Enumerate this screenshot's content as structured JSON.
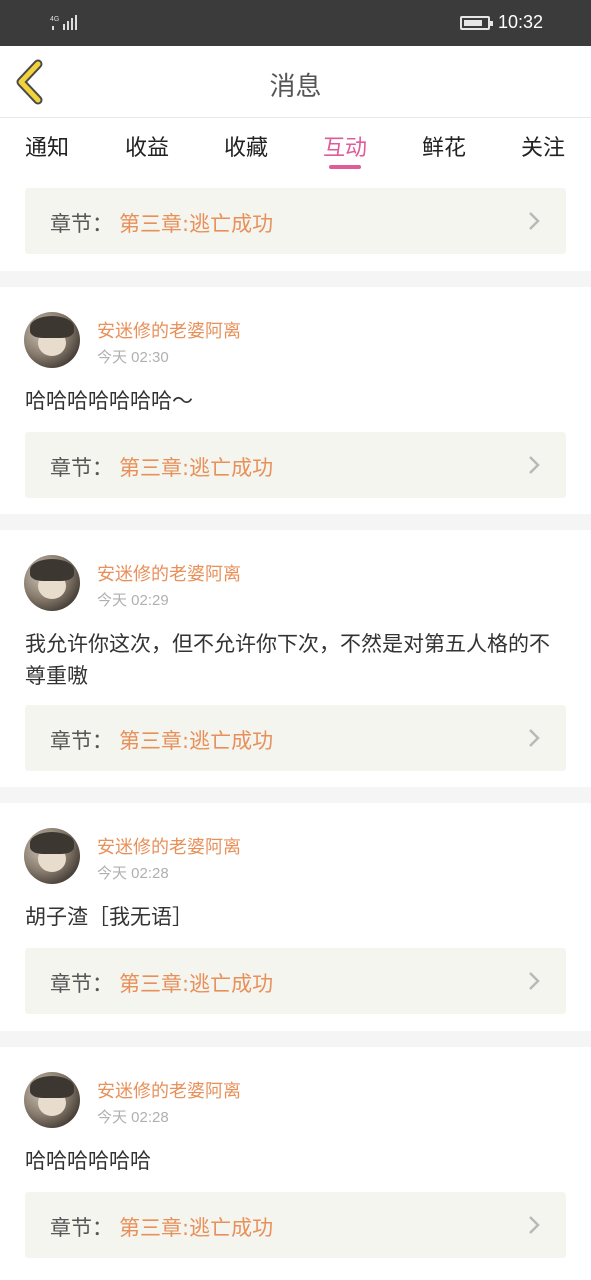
{
  "status_bar": {
    "network": "4G",
    "time": "10:32"
  },
  "header": {
    "title": "消息"
  },
  "tabs": [
    {
      "label": "通知"
    },
    {
      "label": "收益"
    },
    {
      "label": "收藏"
    },
    {
      "label": "互动",
      "active": true
    },
    {
      "label": "鲜花"
    },
    {
      "label": "关注"
    }
  ],
  "chapter_prefix": "章节：",
  "top_chapter": "第三章:逃亡成功",
  "messages": [
    {
      "user": "安迷修的老婆阿离",
      "time": "今天 02:30",
      "text": "哈哈哈哈哈哈哈～",
      "chapter": "第三章:逃亡成功"
    },
    {
      "user": "安迷修的老婆阿离",
      "time": "今天 02:29",
      "text": "我允许你这次，但不允许你下次，不然是对第五人格的不尊重嗷",
      "chapter": "第三章:逃亡成功"
    },
    {
      "user": "安迷修的老婆阿离",
      "time": "今天 02:28",
      "text": "胡子渣［我无语］",
      "chapter": "第三章:逃亡成功"
    },
    {
      "user": "安迷修的老婆阿离",
      "time": "今天 02:28",
      "text": "哈哈哈哈哈哈",
      "chapter": "第三章:逃亡成功"
    }
  ],
  "colors": {
    "accent": "#e05c98",
    "username": "#e8905a",
    "status_bar": "#3b3b3b"
  }
}
